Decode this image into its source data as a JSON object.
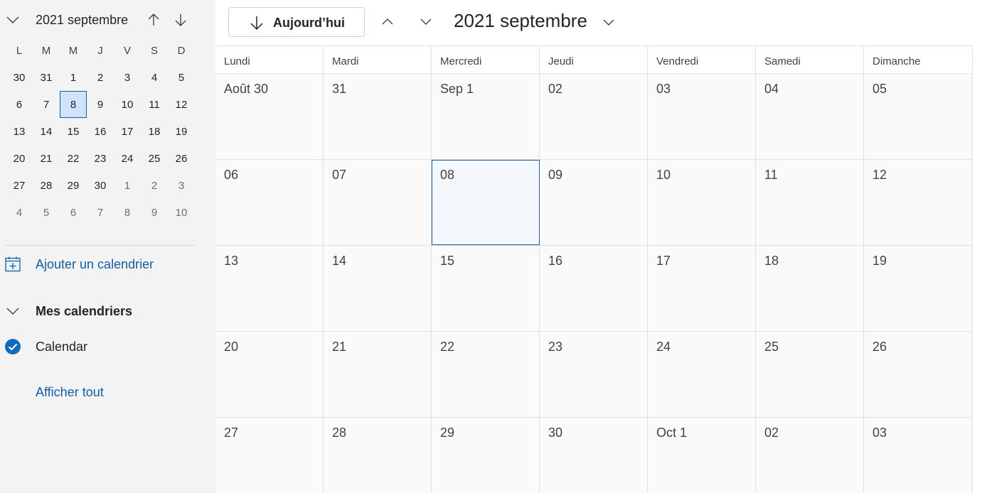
{
  "sidebar": {
    "mini_calendar": {
      "title": "2021 septembre",
      "weekdays": [
        "L",
        "M",
        "M",
        "J",
        "V",
        "S",
        "D"
      ],
      "weeks": [
        [
          {
            "d": "30",
            "out": false
          },
          {
            "d": "31",
            "out": false
          },
          {
            "d": "1",
            "out": false
          },
          {
            "d": "2",
            "out": false
          },
          {
            "d": "3",
            "out": false
          },
          {
            "d": "4",
            "out": false
          },
          {
            "d": "5",
            "out": false
          }
        ],
        [
          {
            "d": "6",
            "out": false
          },
          {
            "d": "7",
            "out": false
          },
          {
            "d": "8",
            "out": false,
            "sel": true
          },
          {
            "d": "9",
            "out": false
          },
          {
            "d": "10",
            "out": false
          },
          {
            "d": "11",
            "out": false
          },
          {
            "d": "12",
            "out": false
          }
        ],
        [
          {
            "d": "13",
            "out": false
          },
          {
            "d": "14",
            "out": false
          },
          {
            "d": "15",
            "out": false
          },
          {
            "d": "16",
            "out": false
          },
          {
            "d": "17",
            "out": false
          },
          {
            "d": "18",
            "out": false
          },
          {
            "d": "19",
            "out": false
          }
        ],
        [
          {
            "d": "20",
            "out": false
          },
          {
            "d": "21",
            "out": false
          },
          {
            "d": "22",
            "out": false
          },
          {
            "d": "23",
            "out": false
          },
          {
            "d": "24",
            "out": false
          },
          {
            "d": "25",
            "out": false
          },
          {
            "d": "26",
            "out": false
          }
        ],
        [
          {
            "d": "27",
            "out": false
          },
          {
            "d": "28",
            "out": false
          },
          {
            "d": "29",
            "out": false
          },
          {
            "d": "30",
            "out": false
          },
          {
            "d": "1",
            "out": true
          },
          {
            "d": "2",
            "out": true
          },
          {
            "d": "3",
            "out": true
          }
        ],
        [
          {
            "d": "4",
            "out": true
          },
          {
            "d": "5",
            "out": true
          },
          {
            "d": "6",
            "out": true
          },
          {
            "d": "7",
            "out": true
          },
          {
            "d": "8",
            "out": true
          },
          {
            "d": "9",
            "out": true
          },
          {
            "d": "10",
            "out": true
          }
        ]
      ]
    },
    "add_calendar_label": "Ajouter un calendrier",
    "my_calendars_label": "Mes calendriers",
    "calendar_item_label": "Calendar",
    "show_all_label": "Afficher tout"
  },
  "toolbar": {
    "today_label": "Aujourd’hui",
    "month_title": "2021 septembre"
  },
  "month_view": {
    "weekdays": [
      "Lundi",
      "Mardi",
      "Mercredi",
      "Jeudi",
      "Vendredi",
      "Samedi",
      "Dimanche"
    ],
    "weeks": [
      [
        {
          "label": "Août 30"
        },
        {
          "label": "31"
        },
        {
          "label": "Sep 1"
        },
        {
          "label": "02"
        },
        {
          "label": "03"
        },
        {
          "label": "04"
        },
        {
          "label": "05"
        }
      ],
      [
        {
          "label": "06"
        },
        {
          "label": "07"
        },
        {
          "label": "08",
          "today": true
        },
        {
          "label": "09"
        },
        {
          "label": "10"
        },
        {
          "label": "11"
        },
        {
          "label": "12"
        }
      ],
      [
        {
          "label": "13"
        },
        {
          "label": "14"
        },
        {
          "label": "15"
        },
        {
          "label": "16"
        },
        {
          "label": "17"
        },
        {
          "label": "18"
        },
        {
          "label": "19"
        }
      ],
      [
        {
          "label": "20"
        },
        {
          "label": "21"
        },
        {
          "label": "22"
        },
        {
          "label": "23"
        },
        {
          "label": "24"
        },
        {
          "label": "25"
        },
        {
          "label": "26"
        }
      ],
      [
        {
          "label": "27"
        },
        {
          "label": "28"
        },
        {
          "label": "29"
        },
        {
          "label": "30"
        },
        {
          "label": "Oct 1"
        },
        {
          "label": "02"
        },
        {
          "label": "03"
        }
      ]
    ]
  },
  "colors": {
    "accent": "#115ea3",
    "selected_bg": "#cfe4fa",
    "sidebar_bg": "#f3f3f3",
    "check_fill": "#0f6cbd"
  }
}
